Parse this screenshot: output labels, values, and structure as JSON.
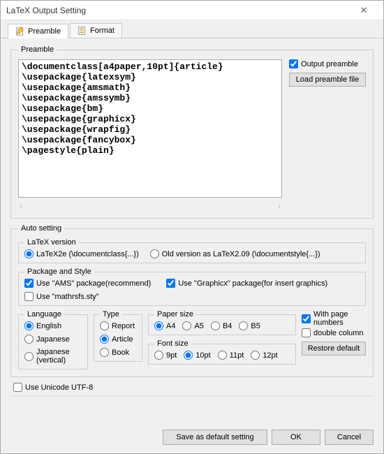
{
  "window": {
    "title": "LaTeX Output Setting"
  },
  "tabs": {
    "preamble": "Preamble",
    "format": "Format"
  },
  "preamble": {
    "legend": "Preamble",
    "text": "\\documentclass[a4paper,10pt]{article}\n\\usepackage{latexsym}\n\\usepackage{amsmath}\n\\usepackage{amssymb}\n\\usepackage{bm}\n\\usepackage{graphicx}\n\\usepackage{wrapfig}\n\\usepackage{fancybox}\n\\pagestyle{plain}",
    "output_preamble": "Output preamble",
    "load_button": "Load preamble file"
  },
  "auto": {
    "legend": "Auto setting",
    "latex_version": {
      "legend": "LaTeX version",
      "opt1": "LaTeX2e (\\documentclass{...})",
      "opt2": "Old version as LaTeX2.09 (\\documentstyle{...})"
    },
    "pkg": {
      "legend": "Package and Style",
      "ams": "Use \"AMS\" package(recommend)",
      "graphicx": "Use \"Graphicx\" package(for insert graphics)",
      "mathrsfs": "Use \"mathrsfs.sty\""
    },
    "language": {
      "legend": "Language",
      "en": "English",
      "ja": "Japanese",
      "jav": "Japanese (vertical)"
    },
    "type": {
      "legend": "Type",
      "report": "Report",
      "article": "Article",
      "book": "Book"
    },
    "paper": {
      "legend": "Paper size",
      "a4": "A4",
      "a5": "A5",
      "b4": "B4",
      "b5": "B5"
    },
    "font": {
      "legend": "Font size",
      "s9": "9pt",
      "s10": "10pt",
      "s11": "11pt",
      "s12": "12pt"
    },
    "page_numbers": "With page numbers",
    "double_column": "double column",
    "restore": "Restore default"
  },
  "unicode": "Use Unicode UTF-8",
  "footer": {
    "save": "Save as default setting",
    "ok": "OK",
    "cancel": "Cancel"
  }
}
